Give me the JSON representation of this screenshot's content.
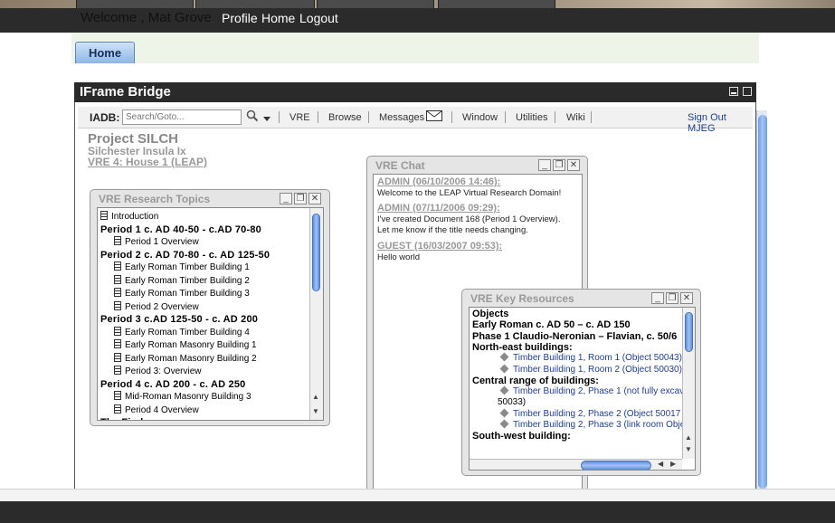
{
  "header": {
    "welcome": "Welcome , Mat Grove",
    "links": [
      "Profile",
      "Home",
      "Logout"
    ]
  },
  "tabs": {
    "home": "Home"
  },
  "iframe": {
    "title": "IFrame Bridge"
  },
  "toolbar": {
    "label": "IADB:",
    "search_placeholder": "Search/Goto...",
    "menu": [
      "VRE",
      "Browse",
      "Messages",
      "Window",
      "Utilities",
      "Wiki"
    ],
    "signout": "Sign Out MJEG"
  },
  "project": {
    "name": "Project SILCH",
    "site": "Silchester Insula Ix",
    "vre": "VRE 4: House 1 (LEAP)"
  },
  "research_topics": {
    "title": "VRE Research Topics",
    "items": [
      {
        "text": "Introduction",
        "type": "doc",
        "level": 0
      },
      {
        "text": "Period 1 c. AD 40-50 - c.AD 70-80",
        "type": "heading",
        "level": 0
      },
      {
        "text": "Period 1 Overview",
        "type": "doc",
        "level": 1
      },
      {
        "text": "Period 2 c. AD 70-80 - c. AD 125-50",
        "type": "heading",
        "level": 0
      },
      {
        "text": "Early Roman Timber Building 1",
        "type": "doc",
        "level": 1
      },
      {
        "text": "Early Roman Timber Building 2",
        "type": "doc",
        "level": 1
      },
      {
        "text": "Early Roman Timber Building 3",
        "type": "doc",
        "level": 1
      },
      {
        "text": "Period 2 Overview",
        "type": "doc",
        "level": 1
      },
      {
        "text": "Period 3 c.AD 125-50 - c. AD 200",
        "type": "heading",
        "level": 0
      },
      {
        "text": "Early Roman Timber Building 4",
        "type": "doc",
        "level": 1
      },
      {
        "text": "Early Roman Masonry Building 1",
        "type": "doc",
        "level": 1
      },
      {
        "text": "Early Roman Masonry Building 2",
        "type": "doc",
        "level": 1
      },
      {
        "text": "Period 3: Overview",
        "type": "doc",
        "level": 1
      },
      {
        "text": "Period 4 c. AD 200 - c. AD 250",
        "type": "heading",
        "level": 0
      },
      {
        "text": "Mid-Roman Masonry Building 3",
        "type": "doc",
        "level": 1
      },
      {
        "text": "Period 4 Overview",
        "type": "doc",
        "level": 1
      },
      {
        "text": "The Finds",
        "type": "heading",
        "level": 0
      }
    ]
  },
  "chat": {
    "title": "VRE Chat",
    "entries": [
      {
        "header": "ADMIN (06/10/2006 14:46):",
        "lines": [
          "Welcome to the LEAP Virtual Research Domain!"
        ]
      },
      {
        "header": "ADMIN (07/11/2006 09:29):",
        "lines": [
          "I've created Document 168 (Period 1 Overview).",
          "Let me know if the title needs changing."
        ]
      },
      {
        "header": "GUEST (16/03/2007 09:53):",
        "lines": [
          "Hello world"
        ]
      }
    ]
  },
  "key_resources": {
    "title": "VRE Key Resources",
    "rows": [
      {
        "text": "Objects",
        "style": "bold"
      },
      {
        "text": "Early Roman c. AD 50 – c. AD 150",
        "style": "bold"
      },
      {
        "text": "Phase 1 Claudio-Neronian – Flavian, c. 50/6",
        "style": "bold"
      },
      {
        "text": "North-east buildings:",
        "style": "bold"
      },
      {
        "text": "Timber Building 1, Room 1 (Object 50043)",
        "style": "link"
      },
      {
        "text": "Timber Building 1, Room 2 (Object 50030)",
        "style": "link"
      },
      {
        "text": "Central range of buildings:",
        "style": "bold"
      },
      {
        "text": "Timber Building 2, Phase 1 (not fully excav",
        "style": "link"
      },
      {
        "text": "50033)",
        "style": "cont"
      },
      {
        "text": "Timber Building 2, Phase 2 (Object 50017",
        "style": "link"
      },
      {
        "text": "Timber Building 2, Phase 3 (link room Obje",
        "style": "link"
      },
      {
        "text": "South-west building:",
        "style": "bold"
      }
    ]
  },
  "icons": {
    "search": "search-icon",
    "mail": "envelope-icon",
    "minimize": "minimize-icon",
    "restore": "restore-icon",
    "close": "close-icon"
  },
  "colors": {
    "topbar": "#2b2b2b",
    "home_tab": "#8db6e6",
    "link": "#1f3f8a",
    "panel_title": "#999999"
  }
}
